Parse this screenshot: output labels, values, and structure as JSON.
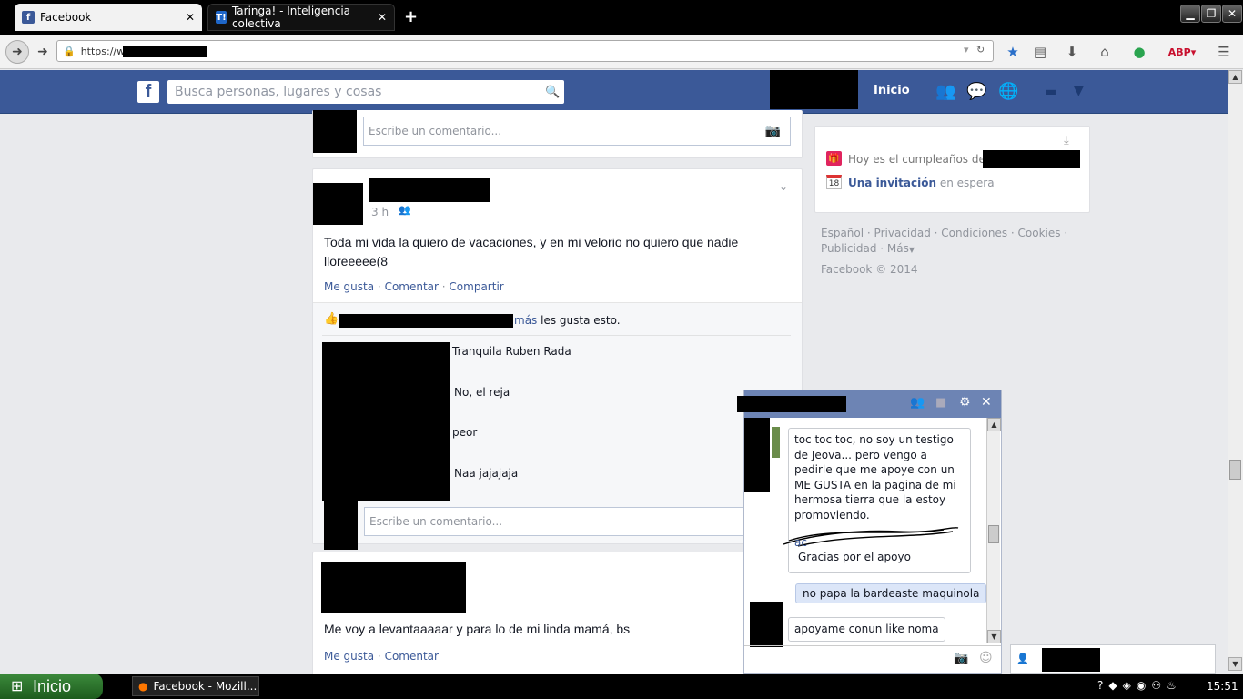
{
  "browser": {
    "tabs": [
      {
        "title": "Facebook",
        "icon": "facebook-favicon"
      },
      {
        "title": "Taringa! - Inteligencia colectiva",
        "icon": "taringa-favicon"
      }
    ],
    "new_tab": "+",
    "url": "https://ww",
    "toolbar_icons": [
      "bookmark-star-icon",
      "reading-list-icon",
      "download-icon",
      "home-icon",
      "extension-icon",
      "adblock-icon",
      "menu-icon"
    ]
  },
  "fb_header": {
    "search_placeholder": "Busca personas, lugares y cosas",
    "home_label": "Inicio"
  },
  "feed": {
    "comment_placeholder": "Escribe un comentario...",
    "post1": {
      "time": "3 h",
      "text": "Toda mi vida la quiero de vacaciones, y en mi velorio no quiero que nadie lloreeeee(8",
      "actions": [
        "Me gusta",
        "Comentar",
        "Compartir"
      ],
      "likes_suffix_link": "más",
      "likes_suffix": "les gusta esto.",
      "comments": [
        "Tranquila Ruben Rada",
        "No, el reja",
        "peor",
        "Naa jajajaja"
      ]
    },
    "post2": {
      "text": "Me voy a levantaaaaar y para lo de mi linda mamá, bs",
      "actions": [
        "Me gusta",
        "Comentar"
      ]
    }
  },
  "right": {
    "birthday_text": "Hoy es el cumpleaños de",
    "invite_bold": "Una invitación",
    "invite_rest": "en espera",
    "calendar_day": "18",
    "footer_links": [
      "Español",
      "Privacidad",
      "Condiciones",
      "Cookies",
      "Publicidad",
      "Más"
    ],
    "copyright": "Facebook © 2014"
  },
  "chat": {
    "incoming_message": "toc toc toc, no soy un testigo de Jeova... pero vengo a pedirle que me apoye con un ME GUSTA en la pagina de mi hermosa tierra que la estoy promoviendo.",
    "incoming_link_tail": "ac",
    "incoming_thanks": "Gracias por el apoyo",
    "outgoing_message": "no papa la bardeaste maquinola",
    "incoming_message_2": "apoyame conun like noma"
  },
  "taskbar": {
    "start_label": "Inicio",
    "app_label": "Facebook - Mozill...",
    "clock": "15:51"
  }
}
